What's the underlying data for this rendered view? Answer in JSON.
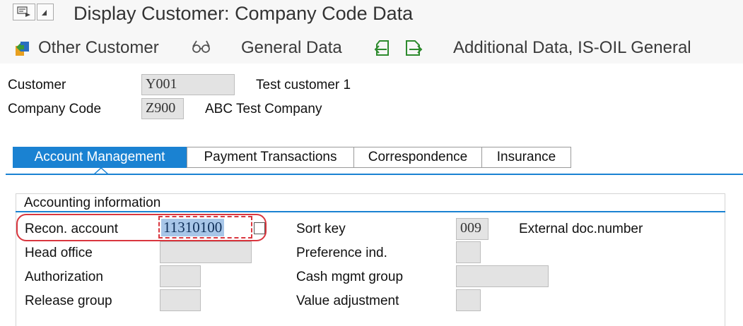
{
  "window": {
    "title": "Display Customer: Company Code Data"
  },
  "toolbar": {
    "other_customer": "Other Customer",
    "general_data": "General Data",
    "additional_data": "Additional Data, IS-OIL General"
  },
  "header": {
    "customer_label": "Customer",
    "customer_value": "Y001",
    "customer_name": "Test customer 1",
    "company_code_label": "Company Code",
    "company_code_value": "Z900",
    "company_name": "ABC Test Company"
  },
  "tabs": [
    {
      "label": "Account Management",
      "active": true
    },
    {
      "label": "Payment Transactions",
      "active": false
    },
    {
      "label": "Correspondence",
      "active": false
    },
    {
      "label": "Insurance",
      "active": false
    }
  ],
  "accounting": {
    "title": "Accounting information",
    "recon_account_label": "Recon. account",
    "recon_account_value": "11310100",
    "head_office_label": "Head office",
    "head_office_value": "",
    "authorization_label": "Authorization",
    "authorization_value": "",
    "release_group_label": "Release group",
    "release_group_value": "",
    "sort_key_label": "Sort key",
    "sort_key_value": "009",
    "sort_key_desc": "External doc.number",
    "preference_label": "Preference ind.",
    "preference_value": "",
    "cash_mgmt_label": "Cash mgmt group",
    "cash_mgmt_value": "",
    "value_adjustment_label": "Value adjustment",
    "value_adjustment_value": ""
  },
  "colors": {
    "accent": "#1a82d2",
    "highlight": "#d9363e",
    "field_bg": "#e3e3e3"
  }
}
